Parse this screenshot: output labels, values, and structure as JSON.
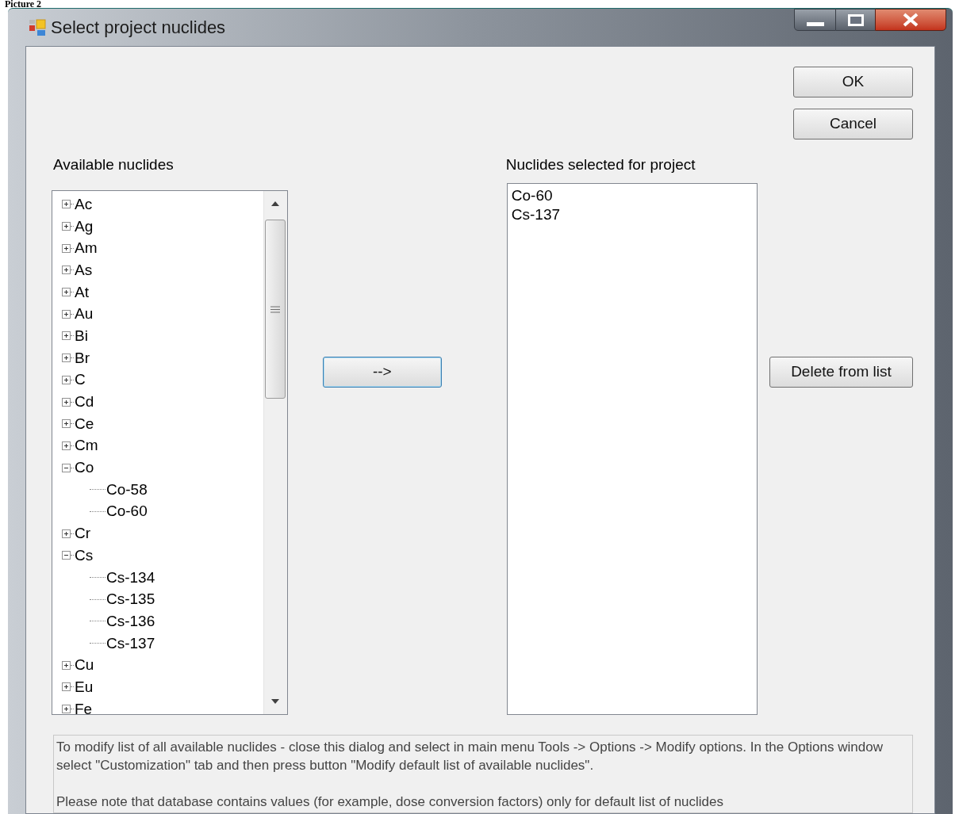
{
  "caption": "Picture 2",
  "window": {
    "title": "Select project nuclides"
  },
  "ok_button": {
    "label": "OK"
  },
  "cancel_button": {
    "label": "Cancel"
  },
  "available": {
    "label": "Available nuclides",
    "tree": [
      {
        "label": "Ac",
        "expanded": false
      },
      {
        "label": "Ag",
        "expanded": false
      },
      {
        "label": "Am",
        "expanded": false
      },
      {
        "label": "As",
        "expanded": false
      },
      {
        "label": "At",
        "expanded": false
      },
      {
        "label": "Au",
        "expanded": false
      },
      {
        "label": "Bi",
        "expanded": false
      },
      {
        "label": "Br",
        "expanded": false
      },
      {
        "label": "C",
        "expanded": false
      },
      {
        "label": "Cd",
        "expanded": false
      },
      {
        "label": "Ce",
        "expanded": false
      },
      {
        "label": "Cm",
        "expanded": false
      },
      {
        "label": "Co",
        "expanded": true,
        "children": [
          {
            "label": "Co-58"
          },
          {
            "label": "Co-60"
          }
        ]
      },
      {
        "label": "Cr",
        "expanded": false
      },
      {
        "label": "Cs",
        "expanded": true,
        "children": [
          {
            "label": "Cs-134"
          },
          {
            "label": "Cs-135"
          },
          {
            "label": "Cs-136"
          },
          {
            "label": "Cs-137"
          }
        ]
      },
      {
        "label": "Cu",
        "expanded": false
      },
      {
        "label": "Eu",
        "expanded": false
      },
      {
        "label": "Fe",
        "expanded": false
      }
    ]
  },
  "add_button": {
    "label": "-->",
    "focused": true
  },
  "selected": {
    "label": "Nuclides selected for project",
    "items": [
      "Co-60",
      "Cs-137"
    ]
  },
  "delete_button": {
    "label": "Delete from list"
  },
  "info": [
    "To modify list of all available nuclides - close this dialog and select in  main menu Tools -> Options -> Modify options. In the Options window select \"Customization\" tab and then press button \"Modify default list of available nuclides\".",
    "Please note that database contains values  (for example, dose conversion factors)  only for default list of  nuclides"
  ]
}
